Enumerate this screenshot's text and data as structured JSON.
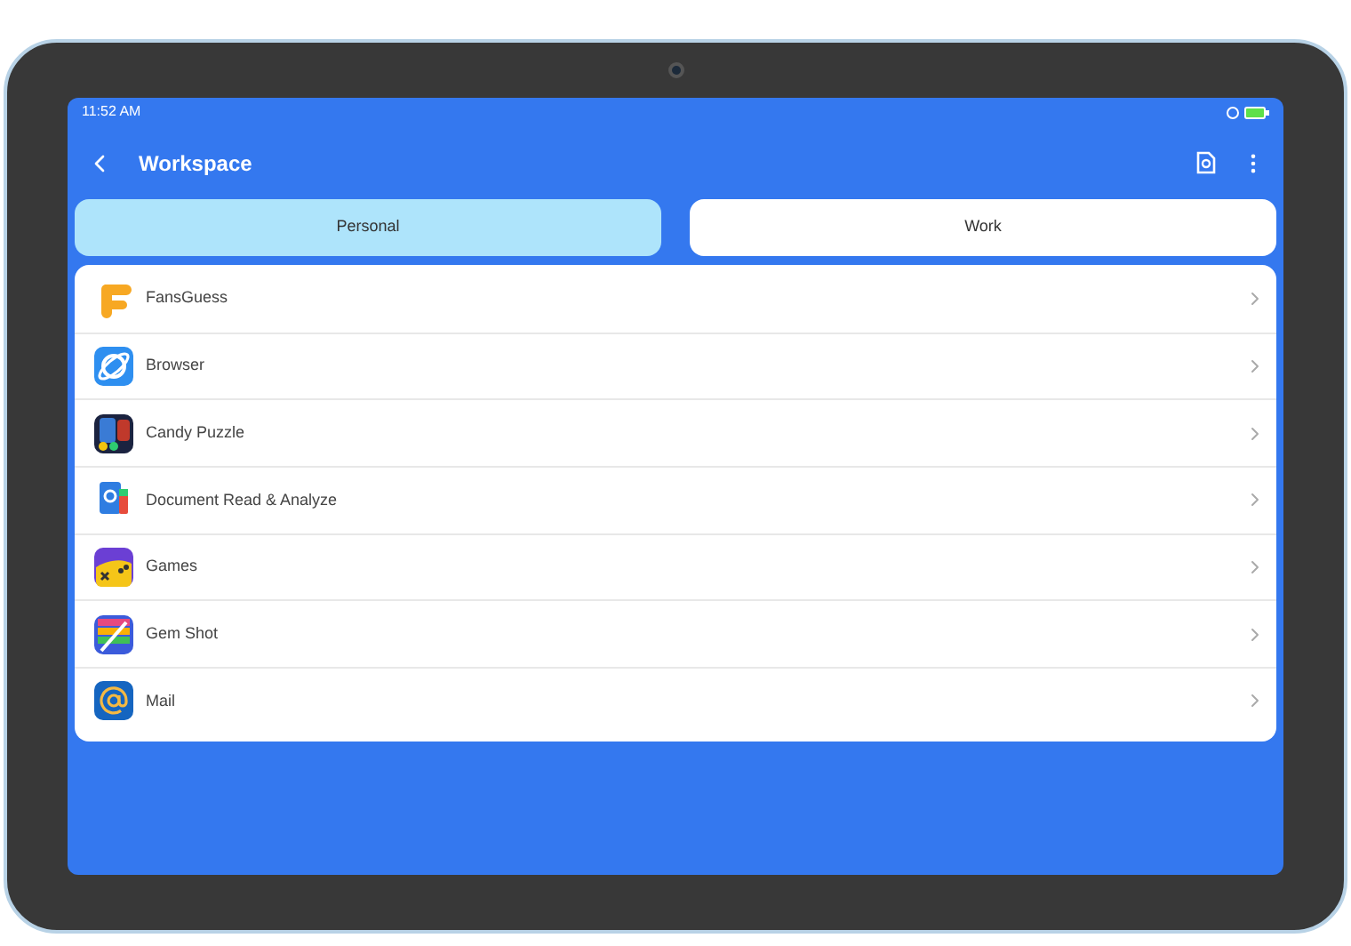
{
  "status_bar": {
    "time": "11:52 AM"
  },
  "header": {
    "title": "Workspace"
  },
  "tabs": [
    {
      "label": "Personal",
      "selected": true
    },
    {
      "label": "Work",
      "selected": false
    }
  ],
  "apps": [
    {
      "name": "FansGuess"
    },
    {
      "name": "Browser"
    },
    {
      "name": "Candy Puzzle"
    },
    {
      "name": "Document Read & Analyze"
    },
    {
      "name": "Games"
    },
    {
      "name": "Gem Shot"
    },
    {
      "name": "Mail"
    }
  ]
}
